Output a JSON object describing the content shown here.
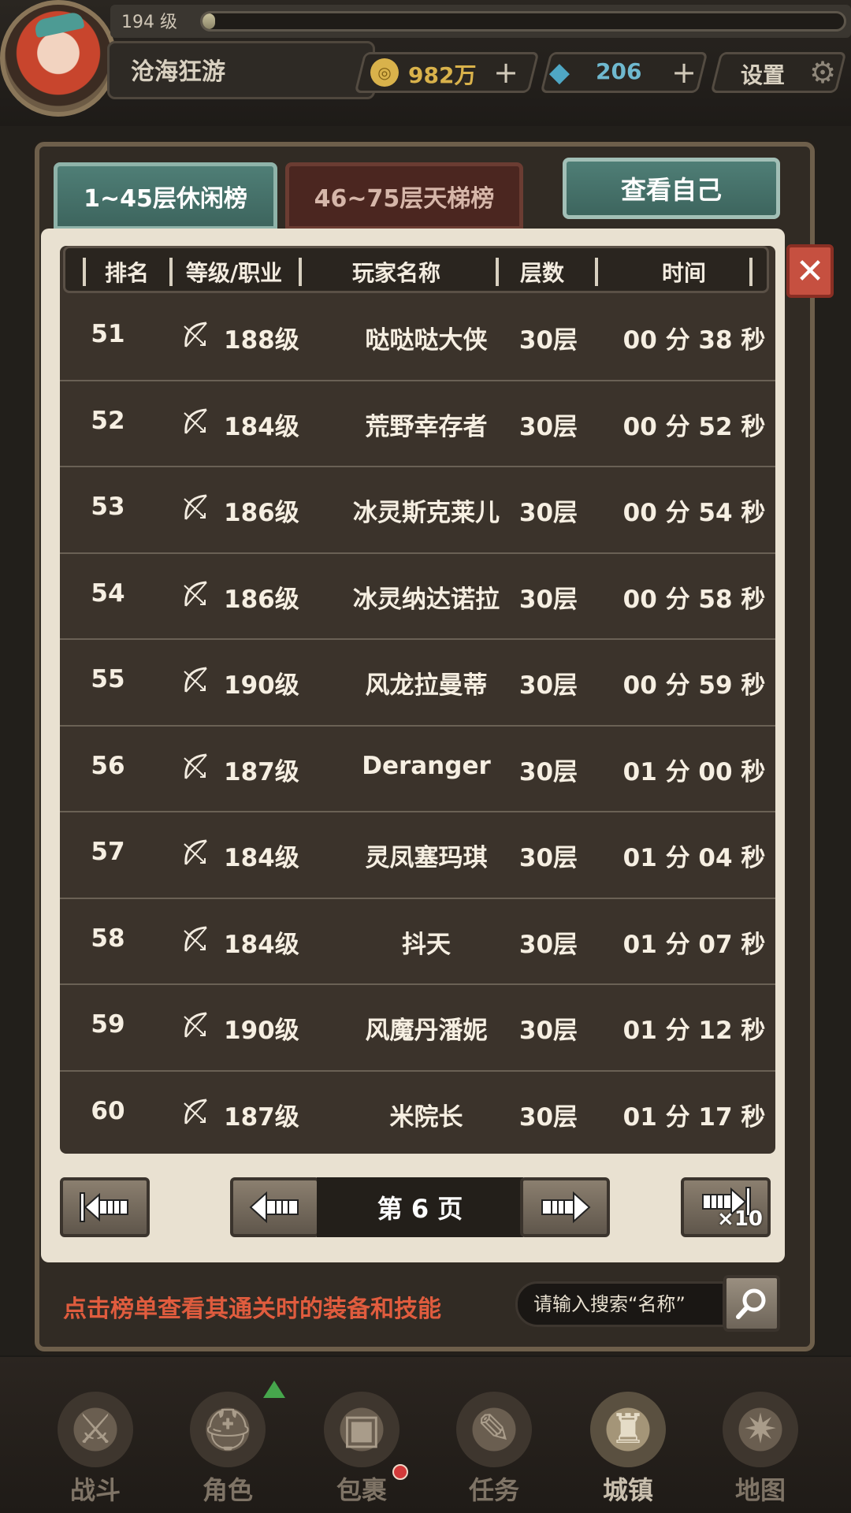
{
  "player": {
    "level_text": "194 级",
    "xp_fraction": 0.02,
    "name": "沧海狂游"
  },
  "resources": {
    "coins": "982万",
    "gems": "206",
    "settings_label": "设置"
  },
  "tabs": {
    "casual": "1~45层休闲榜",
    "ladder": "46~75层天梯榜"
  },
  "view_self_label": "查看自己",
  "table": {
    "headers": [
      "排名",
      "等级/职业",
      "玩家名称",
      "层数",
      "时间"
    ],
    "rows": [
      {
        "rank": "51",
        "level": "188级",
        "name": "哒哒哒大侠",
        "floor": "30层",
        "time": "00 分 38 秒"
      },
      {
        "rank": "52",
        "level": "184级",
        "name": "荒野幸存者",
        "floor": "30层",
        "time": "00 分 52 秒"
      },
      {
        "rank": "53",
        "level": "186级",
        "name": "冰灵斯克莱儿",
        "floor": "30层",
        "time": "00 分 54 秒"
      },
      {
        "rank": "54",
        "level": "186级",
        "name": "冰灵纳达诺拉",
        "floor": "30层",
        "time": "00 分 58 秒"
      },
      {
        "rank": "55",
        "level": "190级",
        "name": "风龙拉曼蒂",
        "floor": "30层",
        "time": "00 分 59 秒"
      },
      {
        "rank": "56",
        "level": "187级",
        "name": "Deranger",
        "floor": "30层",
        "time": "01 分 00 秒"
      },
      {
        "rank": "57",
        "level": "184级",
        "name": "灵凤塞玛琪",
        "floor": "30层",
        "time": "01 分 04 秒"
      },
      {
        "rank": "58",
        "level": "184级",
        "name": "抖天",
        "floor": "30层",
        "time": "01 分 07 秒"
      },
      {
        "rank": "59",
        "level": "190级",
        "name": "风魔丹潘妮",
        "floor": "30层",
        "time": "01 分 12 秒"
      },
      {
        "rank": "60",
        "level": "187级",
        "name": "米院长",
        "floor": "30层",
        "time": "01 分 17 秒"
      }
    ],
    "class_icon": "bow-icon"
  },
  "pagination": {
    "page_label": "第 6 页",
    "jump_label": "×10"
  },
  "hint": "点击榜单查看其通关时的装备和技能",
  "search": {
    "placeholder": "请输入搜索“名称”"
  },
  "nav": {
    "items": [
      {
        "label": "战斗",
        "icon": "crossed-swords-icon"
      },
      {
        "label": "角色",
        "icon": "helmet-icon"
      },
      {
        "label": "包裹",
        "icon": "bag-icon"
      },
      {
        "label": "任务",
        "icon": "scroll-icon"
      },
      {
        "label": "城镇",
        "icon": "castle-icon"
      },
      {
        "label": "地图",
        "icon": "map-icon"
      }
    ]
  },
  "colors": {
    "accent_teal": "#4f7e76",
    "hint_red": "#e05c3e",
    "close_red": "#c65040"
  }
}
